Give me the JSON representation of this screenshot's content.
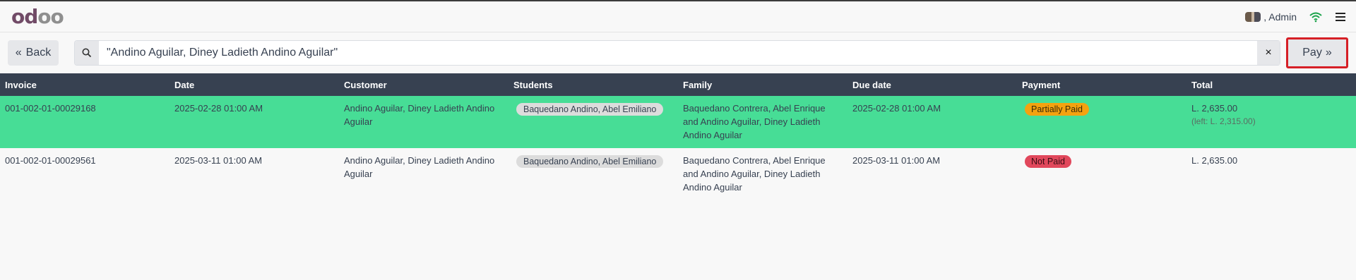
{
  "header": {
    "logo_part1": "od",
    "logo_part2": "oo",
    "user_label": ", Admin",
    "icons": [
      "avatar",
      "wifi-icon",
      "hamburger-menu-icon"
    ]
  },
  "search": {
    "back_label": "Back",
    "query": "\"Andino Aguilar, Diney Ladieth Andino Aguilar\"",
    "clear_symbol": "×",
    "pay_label": "Pay"
  },
  "table": {
    "columns": [
      "Invoice",
      "Date",
      "Customer",
      "Students",
      "Family",
      "Due date",
      "Payment",
      "Total"
    ],
    "rows": [
      {
        "invoice": "001-002-01-00029168",
        "date": "2025-02-28 01:00 AM",
        "customer": "Andino Aguilar, Diney Ladieth Andino Aguilar",
        "student": "Baquedano Andino, Abel Emiliano",
        "family": "Baquedano Contrera, Abel Enrique and Andino Aguilar, Diney Ladieth Andino Aguilar",
        "due_date": "2025-02-28 01:00 AM",
        "payment": "Partially Paid",
        "total": "L. 2,635.00",
        "left": "(left: L. 2,315.00)"
      },
      {
        "invoice": "001-002-01-00029561",
        "date": "2025-03-11 01:00 AM",
        "customer": "Andino Aguilar, Diney Ladieth Andino Aguilar",
        "student": "Baquedano Andino, Abel Emiliano",
        "family": "Baquedano Contrera, Abel Enrique and Andino Aguilar, Diney Ladieth Andino Aguilar",
        "due_date": "2025-03-11 01:00 AM",
        "payment": "Not Paid",
        "total": "L. 2,635.00"
      }
    ]
  },
  "colors": {
    "highlight_row": "#47dd96",
    "header_bg": "#374151",
    "partially_paid": "#f4a20f",
    "not_paid": "#e1485c",
    "pay_outline": "#d61f26"
  }
}
